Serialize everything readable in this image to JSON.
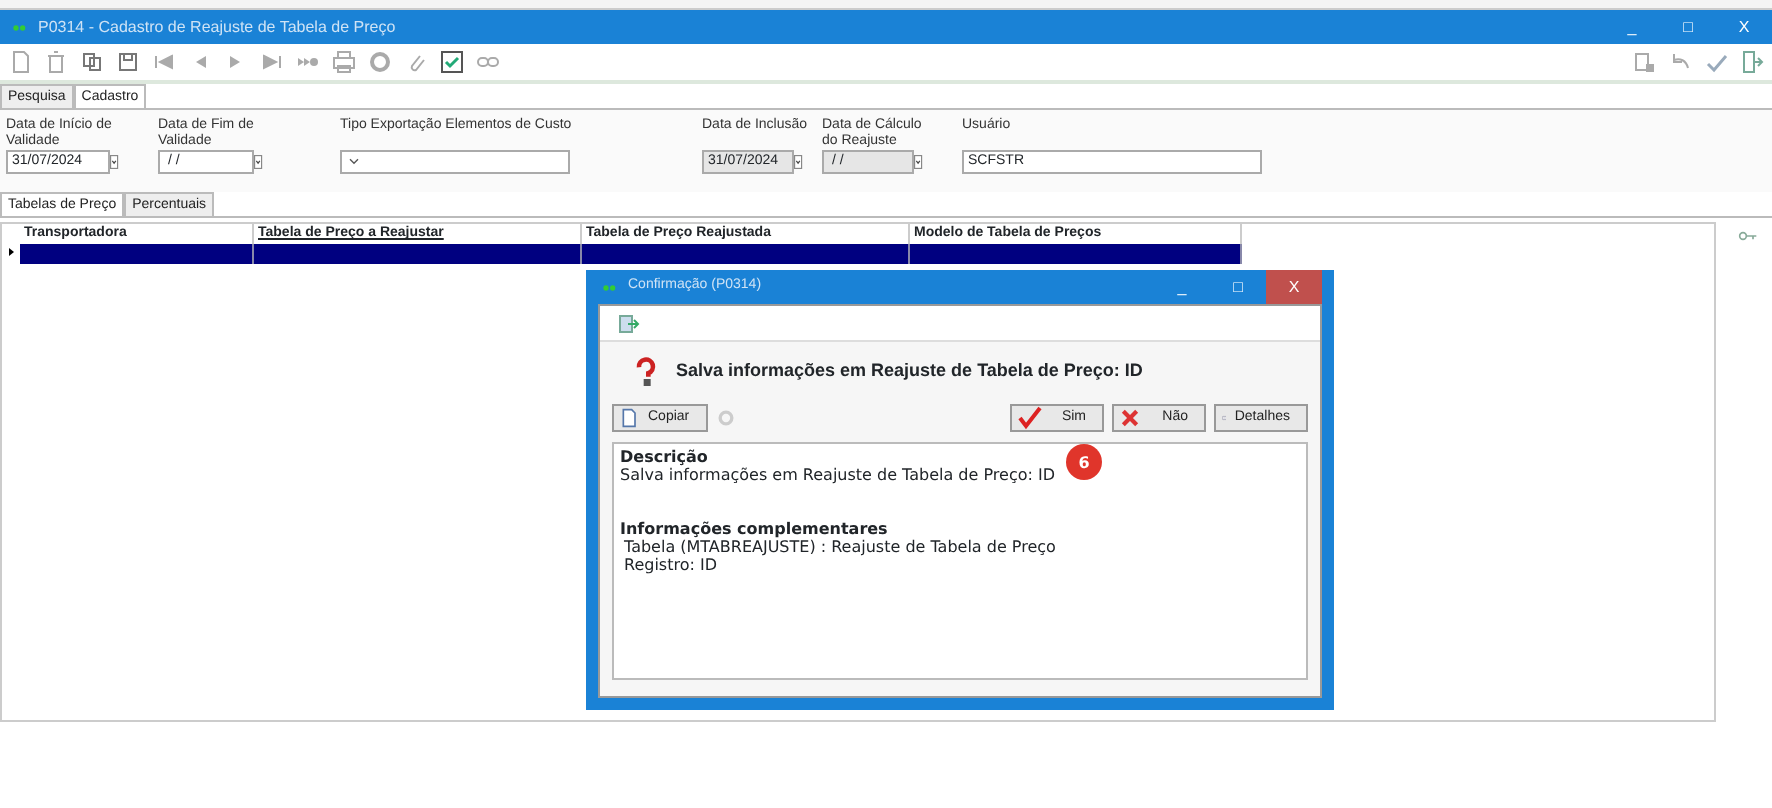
{
  "window": {
    "title": "P0314 - Cadastro de Reajuste de Tabela de Preço",
    "controls": [
      "_",
      "□",
      "X"
    ]
  },
  "main_tabs": [
    {
      "label": "Pesquisa",
      "selected": false
    },
    {
      "label": "Cadastro",
      "selected": true
    }
  ],
  "fields": [
    {
      "label": "Data de Início de Validade",
      "value": "31/07/2024",
      "kind": "date",
      "disabled": false
    },
    {
      "label": "Data de Fim de Validade",
      "value": " / /",
      "kind": "date",
      "disabled": false
    },
    {
      "label": "Tipo Exportação Elementos de Custo",
      "kind": "select",
      "disabled": false
    },
    {
      "label": "Data de Inclusão",
      "value": "31/07/2024",
      "kind": "date",
      "disabled": true
    },
    {
      "label": "Data de Cálculo do Reajuste",
      "value": " / /",
      "kind": "date",
      "disabled": true
    },
    {
      "label": "Usuário",
      "value": "SCFSTR",
      "kind": "text",
      "disabled": false
    }
  ],
  "inner_tabs": [
    {
      "label": "Tabelas de Preço",
      "selected": true
    },
    {
      "label": "Percentuais",
      "selected": false
    }
  ],
  "grid": {
    "columns": [
      {
        "label": "Transportadora",
        "underlined": false
      },
      {
        "label": "Tabela de Preço a Reajustar",
        "underlined": true
      },
      {
        "label": "Tabela de Preço Reajustada",
        "underlined": false
      },
      {
        "label": "Modelo de Tabela de Preços",
        "underlined": false
      }
    ],
    "rows": [
      {
        "selected": true
      }
    ]
  },
  "dialog": {
    "title": "Confirmação (P0314)",
    "controls": [
      "_",
      "□",
      "X"
    ],
    "heading": "Salva informações em Reajuste de Tabela de Preço: ID",
    "copy_button": "Copiar",
    "buttons": [
      {
        "label": "Sim",
        "kind": "yes"
      },
      {
        "label": "Não",
        "kind": "no"
      },
      {
        "label": "Detalhes",
        "kind": "details"
      }
    ],
    "description_title": "Descrição",
    "description": "Salva informações em Reajuste de Tabela de Preço: ID",
    "info_title": "Informações complementares",
    "info_lines": [
      "Tabela (MTABREAJUSTE) : Reajuste de Tabela de Preço",
      "Registro: ID"
    ],
    "badge": "6"
  }
}
